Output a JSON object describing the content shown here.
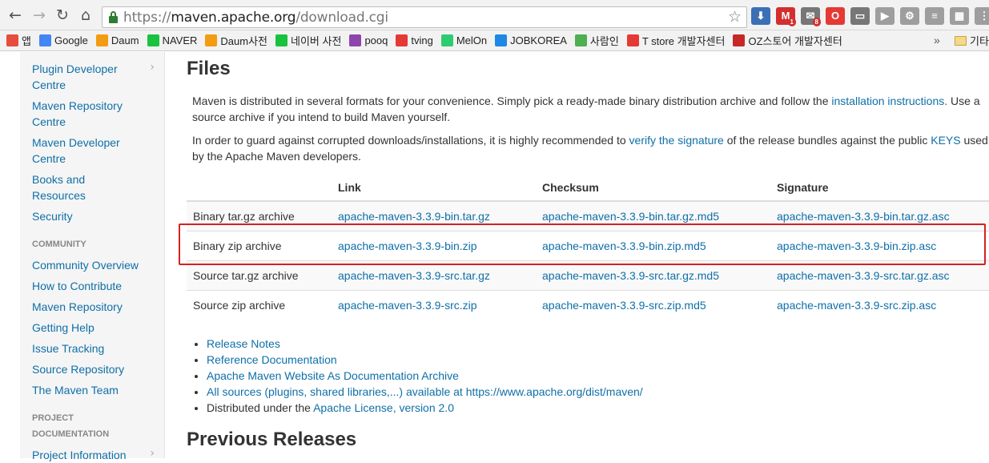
{
  "browser": {
    "url_scheme": "https://",
    "url_host": "maven.apache.org",
    "url_path": "/download.cgi",
    "extensions": [
      {
        "name": "download-icon",
        "color": "#3b6fb6",
        "glyph": "⬇"
      },
      {
        "name": "gmail-icon",
        "color": "#d32f2f",
        "glyph": "M",
        "badge": "1"
      },
      {
        "name": "mail-check-icon",
        "color": "#777777",
        "glyph": "✉",
        "badge": "8"
      },
      {
        "name": "opera-icon",
        "color": "#e53935",
        "glyph": "O"
      },
      {
        "name": "cast-icon",
        "color": "#777777",
        "glyph": "▭"
      },
      {
        "name": "youtube-icon",
        "color": "#9e9e9e",
        "glyph": "▶"
      },
      {
        "name": "settings-icon",
        "color": "#9e9e9e",
        "glyph": "⚙"
      },
      {
        "name": "menu-icon",
        "color": "#9e9e9e",
        "glyph": "≡"
      },
      {
        "name": "extension-icon",
        "color": "#9e9e9e",
        "glyph": "▦"
      },
      {
        "name": "chrome-menu-icon",
        "color": "#9e9e9e",
        "glyph": "⋮"
      }
    ]
  },
  "bookmarks": [
    {
      "label": "앱",
      "icon": "apps-icon",
      "color": "#e74c3c"
    },
    {
      "label": "Google",
      "icon": "google-icon",
      "color": "#4285f4"
    },
    {
      "label": "Daum",
      "icon": "daum-icon",
      "color": "#f39c12"
    },
    {
      "label": "NAVER",
      "icon": "naver-icon",
      "color": "#19c33d"
    },
    {
      "label": "Daum사전",
      "icon": "daum-dict-icon",
      "color": "#f39c12"
    },
    {
      "label": "네이버 사전",
      "icon": "naver-dict-icon",
      "color": "#19c33d"
    },
    {
      "label": "pooq",
      "icon": "pooq-icon",
      "color": "#8e44ad"
    },
    {
      "label": "tving",
      "icon": "tving-icon",
      "color": "#e53935"
    },
    {
      "label": "MelOn",
      "icon": "melon-icon",
      "color": "#2ecc71"
    },
    {
      "label": "JOBKOREA",
      "icon": "jobkorea-icon",
      "color": "#1e88e5"
    },
    {
      "label": "사람인",
      "icon": "saramin-icon",
      "color": "#4caf50"
    },
    {
      "label": "T store 개발자센터",
      "icon": "tstore-icon",
      "color": "#e53935"
    },
    {
      "label": "OZ스토어 개발자센터",
      "icon": "ozstore-icon",
      "color": "#c62828"
    }
  ],
  "bookmarks_more": "»",
  "bookmarks_other": "기타",
  "sidebar": {
    "top_items": [
      {
        "label": "Plugin Developer Centre",
        "chevron": true
      },
      {
        "label": "Maven Repository Centre",
        "chevron": false
      },
      {
        "label": "Maven Developer Centre",
        "chevron": false
      },
      {
        "label": "Books and Resources",
        "chevron": false
      },
      {
        "label": "Security",
        "chevron": false
      }
    ],
    "community_header": "COMMUNITY",
    "community_items": [
      {
        "label": "Community Overview"
      },
      {
        "label": "How to Contribute"
      },
      {
        "label": "Maven Repository"
      },
      {
        "label": "Getting Help"
      },
      {
        "label": "Issue Tracking"
      },
      {
        "label": "Source Repository"
      },
      {
        "label": "The Maven Team"
      }
    ],
    "project_header": "PROJECT DOCUMENTATION",
    "project_items": [
      {
        "label": "Project Information",
        "chevron": true
      }
    ]
  },
  "content": {
    "title": "Files",
    "intro_a": "Maven is distributed in several formats for your convenience. Simply pick a ready-made binary distribution archive and follow the ",
    "intro_link": "installation instructions.",
    "intro_b": " Use a source archive if you intend to build Maven yourself.",
    "verify_a": "In order to guard against corrupted downloads/installations, it is highly recommended to ",
    "verify_link": "verify the signature",
    "verify_b": " of the release bundles against the public ",
    "verify_keys": "KEYS",
    "verify_c": " used by the Apache Maven developers.",
    "table": {
      "headers": [
        "",
        "Link",
        "Checksum",
        "Signature"
      ],
      "rows": [
        [
          "Binary tar.gz archive",
          "apache-maven-3.3.9-bin.tar.gz",
          "apache-maven-3.3.9-bin.tar.gz.md5",
          "apache-maven-3.3.9-bin.tar.gz.asc"
        ],
        [
          "Binary zip archive",
          "apache-maven-3.3.9-bin.zip",
          "apache-maven-3.3.9-bin.zip.md5",
          "apache-maven-3.3.9-bin.zip.asc"
        ],
        [
          "Source tar.gz archive",
          "apache-maven-3.3.9-src.tar.gz",
          "apache-maven-3.3.9-src.tar.gz.md5",
          "apache-maven-3.3.9-src.tar.gz.asc"
        ],
        [
          "Source zip archive",
          "apache-maven-3.3.9-src.zip",
          "apache-maven-3.3.9-src.zip.md5",
          "apache-maven-3.3.9-src.zip.asc"
        ]
      ]
    },
    "links": {
      "release_notes": "Release Notes",
      "reference_docs": "Reference Documentation",
      "website_archive": "Apache Maven Website As Documentation Archive",
      "all_sources": "All sources (plugins, shared libraries,...) available at https://www.apache.org/dist/maven/",
      "license_prefix": "Distributed under the ",
      "license_link": "Apache License, version 2.0"
    },
    "previous_title": "Previous Releases"
  },
  "highlight_color": "#d62020"
}
